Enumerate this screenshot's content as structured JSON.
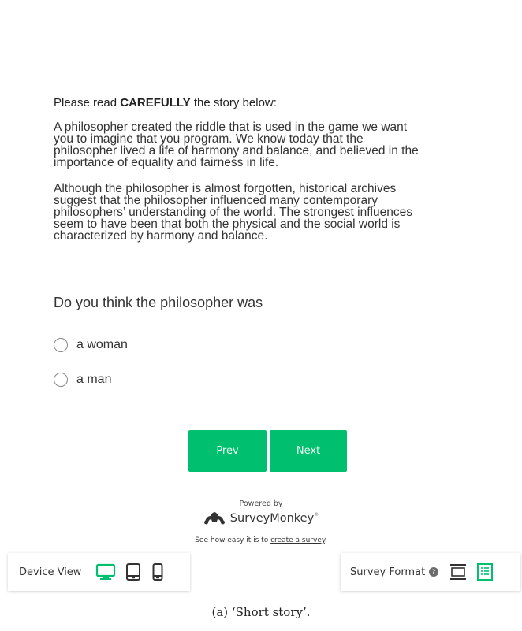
{
  "story": {
    "intro_prefix": "Please read ",
    "intro_bold": "CAREFULLY",
    "intro_suffix": " the story below:",
    "paragraph1_lines": [
      "A philosopher created the riddle that is used in the game we want",
      "you to imagine that you program. We know today that the",
      "philosopher lived a life of harmony and balance, and believed in the",
      "importance of equality and fairness in life."
    ],
    "paragraph2_lines": [
      "Although the philosopher is almost forgotten, historical archives",
      "suggest that the philosopher influenced many contemporary",
      "philosophers’ understanding of the world. The strongest influences",
      "seem to have been that both the physical and the social world is",
      "characterized by harmony and balance."
    ]
  },
  "question": {
    "text": "Do you think the philosopher was",
    "options": [
      "a woman",
      "a man"
    ]
  },
  "nav": {
    "prev_label": "Prev",
    "next_label": "Next"
  },
  "footer": {
    "powered_by": "Powered by",
    "brand": "SurveyMonkey",
    "brand_reg": "®",
    "tagline_prefix": "See how easy it is to ",
    "tagline_link": "create a survey",
    "tagline_suffix": "."
  },
  "device_view": {
    "label": "Device View",
    "icons": [
      "desktop-icon",
      "tablet-icon",
      "mobile-icon"
    ],
    "active": "desktop-icon"
  },
  "survey_format": {
    "label": "Survey Format",
    "icons": [
      "help-icon",
      "classic-format-icon",
      "list-format-icon"
    ],
    "active": "list-format-icon"
  },
  "caption": "(a) ‘Short story’.",
  "colors": {
    "accent": "#00bf6f",
    "button_text": "#e8fff3",
    "text": "#333333"
  }
}
